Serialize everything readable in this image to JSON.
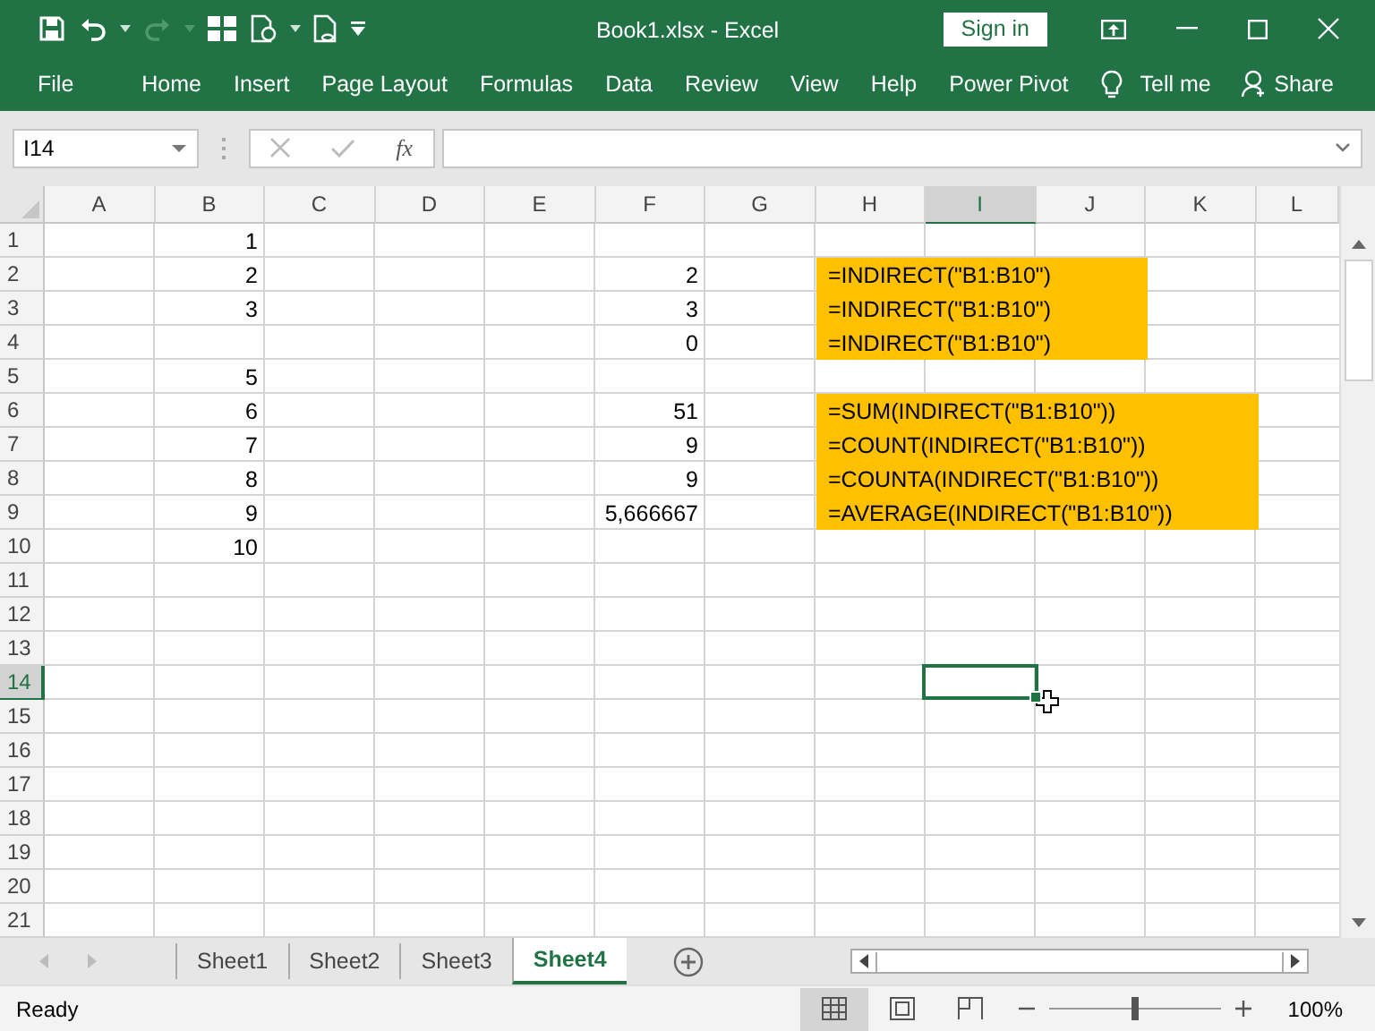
{
  "window": {
    "title": "Book1.xlsx  -  Excel",
    "sign_in": "Sign in"
  },
  "ribbon_tabs": [
    {
      "label": "File"
    },
    {
      "label": "Home"
    },
    {
      "label": "Insert"
    },
    {
      "label": "Page Layout"
    },
    {
      "label": "Formulas"
    },
    {
      "label": "Data"
    },
    {
      "label": "Review"
    },
    {
      "label": "View"
    },
    {
      "label": "Help"
    },
    {
      "label": "Power Pivot"
    }
  ],
  "tell_me": "Tell me",
  "share": "Share",
  "formula_bar": {
    "name_box": "I14",
    "fx": "fx"
  },
  "columns": [
    {
      "label": "A",
      "selected": false
    },
    {
      "label": "B",
      "selected": false
    },
    {
      "label": "C",
      "selected": false
    },
    {
      "label": "D",
      "selected": false
    },
    {
      "label": "E",
      "selected": false
    },
    {
      "label": "F",
      "selected": false
    },
    {
      "label": "G",
      "selected": false
    },
    {
      "label": "H",
      "selected": false
    },
    {
      "label": "I",
      "selected": true
    },
    {
      "label": "J",
      "selected": false
    },
    {
      "label": "K",
      "selected": false
    },
    {
      "label": "L",
      "selected": false
    }
  ],
  "rows": [
    {
      "label": "1",
      "selected": false,
      "cells": [
        null,
        {
          "text": "1",
          "kind": "number"
        }
      ]
    },
    {
      "label": "2",
      "selected": false,
      "cells": [
        null,
        {
          "text": "2",
          "kind": "number"
        },
        null,
        null,
        null,
        {
          "text": "2",
          "kind": "number"
        },
        null,
        {
          "text": "=INDIRECT(\"B1:B10\")",
          "kind": "text",
          "color": "#ffc000"
        },
        {
          "color": "#ffc000"
        },
        {
          "color": "#ffc000"
        }
      ]
    },
    {
      "label": "3",
      "selected": false,
      "cells": [
        null,
        {
          "text": "3",
          "kind": "number"
        },
        null,
        null,
        null,
        {
          "text": "3",
          "kind": "number"
        },
        null,
        {
          "text": "=INDIRECT(\"B1:B10\")",
          "kind": "text",
          "color": "#ffc000"
        },
        {
          "color": "#ffc000"
        },
        {
          "color": "#ffc000"
        }
      ]
    },
    {
      "label": "4",
      "selected": false,
      "cells": [
        null,
        null,
        null,
        null,
        null,
        {
          "text": "0",
          "kind": "number"
        },
        null,
        {
          "text": "=INDIRECT(\"B1:B10\")",
          "kind": "text",
          "color": "#ffc000"
        },
        {
          "color": "#ffc000"
        },
        {
          "color": "#ffc000"
        }
      ]
    },
    {
      "label": "5",
      "selected": false,
      "cells": [
        null,
        {
          "text": "5",
          "kind": "number"
        }
      ]
    },
    {
      "label": "6",
      "selected": false,
      "cells": [
        null,
        {
          "text": "6",
          "kind": "number"
        },
        null,
        null,
        null,
        {
          "text": "51",
          "kind": "number"
        },
        null,
        {
          "text": "=SUM(INDIRECT(\"B1:B10\"))",
          "kind": "text",
          "color": "#ffc000"
        },
        {
          "color": "#ffc000"
        },
        {
          "color": "#ffc000"
        },
        {
          "color": "#ffc000"
        }
      ]
    },
    {
      "label": "7",
      "selected": false,
      "cells": [
        null,
        {
          "text": "7",
          "kind": "number"
        },
        null,
        null,
        null,
        {
          "text": "9",
          "kind": "number"
        },
        null,
        {
          "text": "=COUNT(INDIRECT(\"B1:B10\"))",
          "kind": "text",
          "color": "#ffc000"
        },
        {
          "color": "#ffc000"
        },
        {
          "color": "#ffc000"
        },
        {
          "color": "#ffc000"
        }
      ]
    },
    {
      "label": "8",
      "selected": false,
      "cells": [
        null,
        {
          "text": "8",
          "kind": "number"
        },
        null,
        null,
        null,
        {
          "text": "9",
          "kind": "number"
        },
        null,
        {
          "text": "=COUNTA(INDIRECT(\"B1:B10\"))",
          "kind": "text",
          "color": "#ffc000"
        },
        {
          "color": "#ffc000"
        },
        {
          "color": "#ffc000"
        },
        {
          "color": "#ffc000"
        }
      ]
    },
    {
      "label": "9",
      "selected": false,
      "cells": [
        null,
        {
          "text": "9",
          "kind": "number"
        },
        null,
        null,
        null,
        {
          "text": "5,666667",
          "kind": "number"
        },
        null,
        {
          "text": "=AVERAGE(INDIRECT(\"B1:B10\"))",
          "kind": "text",
          "color": "#ffc000"
        },
        {
          "color": "#ffc000"
        },
        {
          "color": "#ffc000"
        },
        {
          "color": "#ffc000"
        }
      ]
    },
    {
      "label": "10",
      "selected": false,
      "cells": [
        null,
        {
          "text": "10",
          "kind": "number"
        }
      ]
    },
    {
      "label": "11",
      "selected": false
    },
    {
      "label": "12",
      "selected": false
    },
    {
      "label": "13",
      "selected": false
    },
    {
      "label": "14",
      "selected": true
    },
    {
      "label": "15",
      "selected": false
    },
    {
      "label": "16",
      "selected": false
    },
    {
      "label": "17",
      "selected": false
    },
    {
      "label": "18",
      "selected": false
    },
    {
      "label": "19",
      "selected": false
    },
    {
      "label": "20",
      "selected": false
    },
    {
      "label": "21",
      "selected": false
    }
  ],
  "sheet_tabs": [
    {
      "label": "Sheet1",
      "selected": false
    },
    {
      "label": "Sheet2",
      "selected": false
    },
    {
      "label": "Sheet3",
      "selected": false
    },
    {
      "label": "Sheet4",
      "selected": true
    }
  ],
  "status_bar": {
    "text": "Ready",
    "views": [
      {
        "kind": "normal",
        "selected": true
      },
      {
        "kind": "page-layout",
        "selected": false
      },
      {
        "kind": "page-break",
        "selected": false
      }
    ],
    "zoom": {
      "level": 0.5,
      "reading": "100%"
    }
  }
}
